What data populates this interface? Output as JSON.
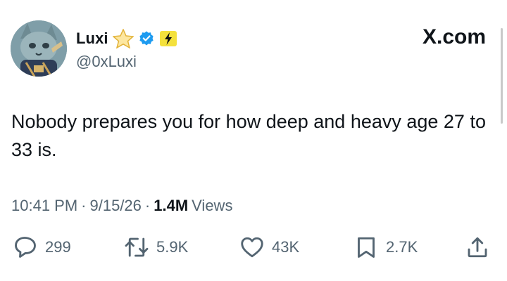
{
  "site": "X.com",
  "author": {
    "display_name": "Luxi",
    "handle": "@0xLuxi",
    "badges": [
      "star-icon",
      "verified-icon",
      "lightning-icon"
    ]
  },
  "tweet": {
    "text": "Nobody prepares you for how deep and heavy age 27 to 33 is.",
    "time": "10:41 PM",
    "date": "9/15/26",
    "views_count": "1.4M",
    "views_label": "Views"
  },
  "actions": {
    "replies": "299",
    "reposts": "5.9K",
    "likes": "43K",
    "bookmarks": "2.7K"
  },
  "colors": {
    "text": "#0f1419",
    "muted": "#536471",
    "verified": "#1d9bf0",
    "star": "#f6c744"
  }
}
